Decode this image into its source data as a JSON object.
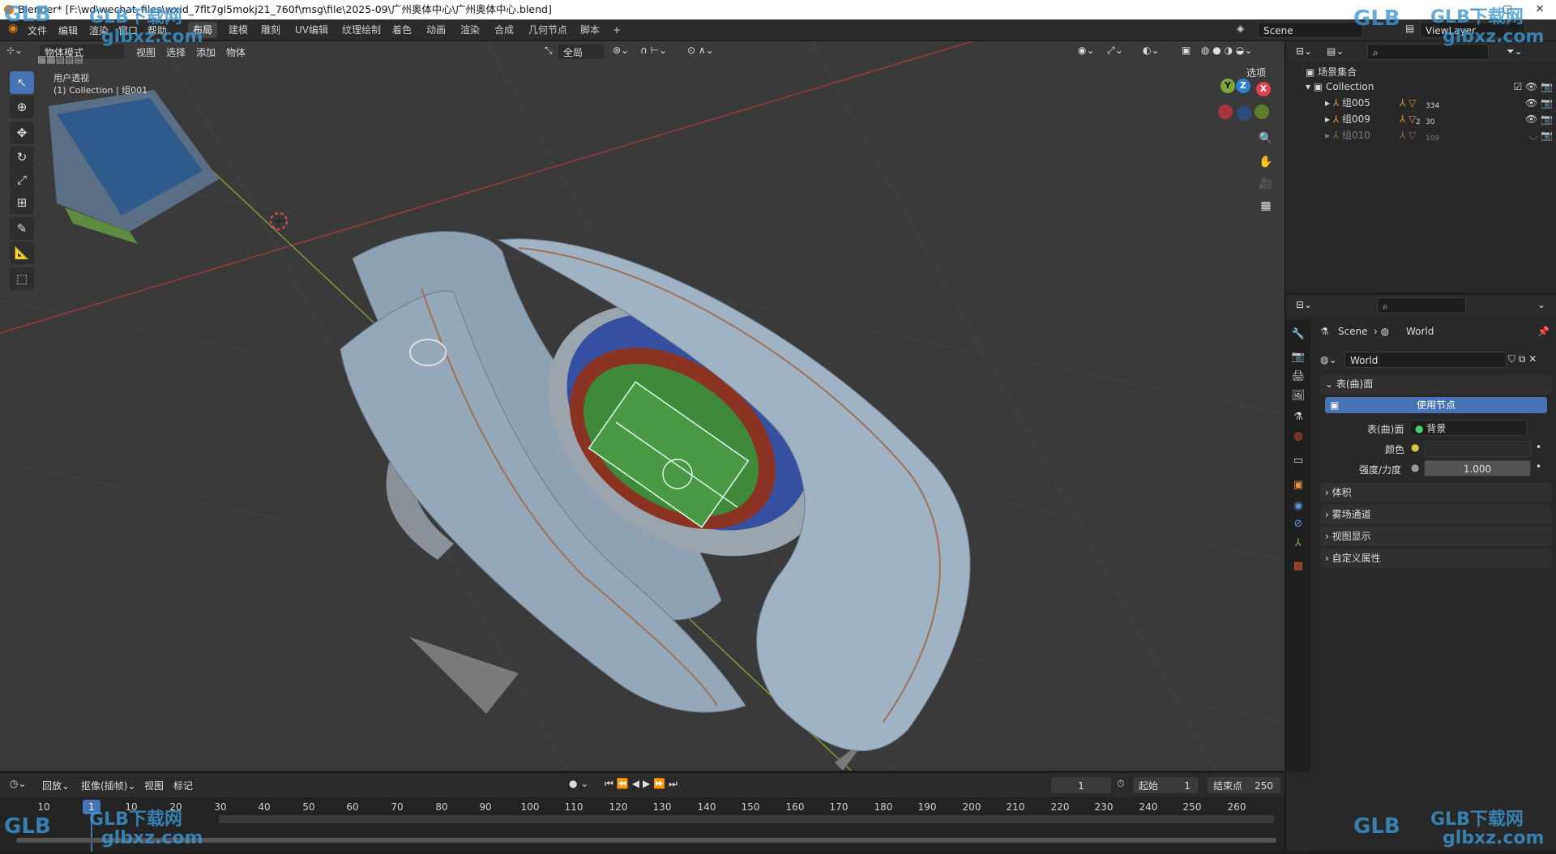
{
  "window": {
    "title": "Blender* [F:\\wd\\wechat_files\\wxid_7flt7gl5mokj21_760f\\msg\\file\\2025-09\\广州奥体中心\\广州奥体中心.blend]",
    "minimize": "—",
    "maximize": "▢",
    "close": "✕"
  },
  "menu": {
    "items": [
      "文件",
      "编辑",
      "渲染",
      "窗口",
      "帮助"
    ],
    "workspaces": [
      "布局",
      "建模",
      "雕刻",
      "UV编辑",
      "纹理绘制",
      "着色",
      "动画",
      "渲染",
      "合成",
      "几何节点",
      "脚本"
    ],
    "active_workspace": "布局",
    "add_tab": "+",
    "scene": "Scene",
    "view_layer": "ViewLayer"
  },
  "viewport": {
    "mode": "物体模式",
    "header_menus": [
      "视图",
      "选择",
      "添加",
      "物体"
    ],
    "transform": "全局",
    "options": "选项",
    "view_name": "用户透视",
    "collection_info": "(1) Collection | 组001",
    "gizmo": {
      "x": "X",
      "y": "Y",
      "z": "Z"
    },
    "colors": {
      "bg": "#3a3a3a",
      "grid": "#4a4a4a",
      "x_axis": "#b33a3a",
      "y_axis": "#7a9a34",
      "roof": "#9fb3c4",
      "seats": "#3d5aa8",
      "field": "#3f8a3a",
      "track": "#8b3323"
    }
  },
  "outliner": {
    "root": "场景集合",
    "collection": "Collection",
    "items": [
      {
        "name": "组005",
        "count": "334"
      },
      {
        "name": "组009",
        "count": "30",
        "sub": "2"
      },
      {
        "name": "组010",
        "count": "109"
      }
    ]
  },
  "properties": {
    "breadcrumb_scene": "Scene",
    "breadcrumb_world": "World",
    "world_name": "World",
    "surface_section": "表(曲)面",
    "use_nodes": "使用节点",
    "surface_label": "表(曲)面",
    "surface_value": "背景",
    "color_label": "颜色",
    "strength_label": "强度/力度",
    "strength_value": "1.000",
    "sections": [
      "体积",
      "雾场通道",
      "视图显示",
      "自定义属性"
    ]
  },
  "timeline": {
    "menus": [
      "回放",
      "抠像(插帧)",
      "视图",
      "标记"
    ],
    "current_frame": "1",
    "start_label": "起始",
    "start_value": "1",
    "end_label": "结束点",
    "end_value": "250",
    "playhead": "1",
    "ticks": [
      "10",
      "10",
      "20",
      "30",
      "40",
      "50",
      "60",
      "70",
      "80",
      "90",
      "100",
      "110",
      "120",
      "130",
      "140",
      "150",
      "160",
      "170",
      "180",
      "190",
      "200",
      "210",
      "220",
      "230",
      "240",
      "250",
      "260"
    ]
  },
  "watermark": {
    "brand": "GLB下载网",
    "site": "glbxz.com",
    "logo": "GLB"
  }
}
